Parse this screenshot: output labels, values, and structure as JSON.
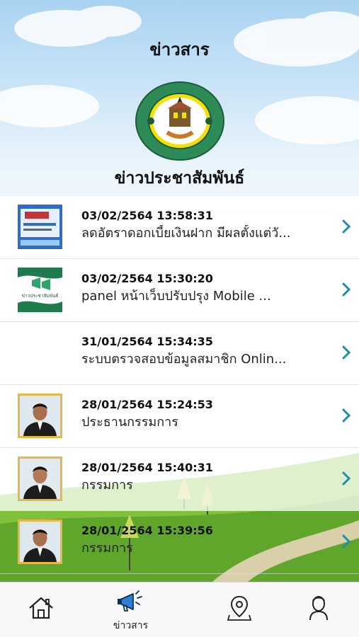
{
  "header": {
    "title": "ข่าวสาร",
    "section_title": "ข่าวประชาสัมพันธ์",
    "logo": {
      "icon": "cooperative-seal-logo",
      "top_text": "สหกรณ์ออมทรัพย์ครู",
      "bottom_text": "นครสวรรค์ จำกัด"
    }
  },
  "news": [
    {
      "date": "03/02/2564 13:58:31",
      "title": "ลดอัตราดอกเบี้ยเงินฝาก มีผลตั้งแต่วั...",
      "thumb": "deposit-rate-thumb"
    },
    {
      "date": "03/02/2564 15:30:20",
      "title": "panel หน้าเว็บปรับปรุง Mobile ...",
      "thumb": "pr-news-thumb",
      "thumb_text": "ข่าวประชาสัมพันธ์"
    },
    {
      "date": "31/01/2564 15:34:35",
      "title": "ระบบตรวจสอบข้อมูลสมาชิก  Onlin...",
      "thumb": "none"
    },
    {
      "date": "28/01/2564 15:24:53",
      "title": "ประธานกรรมการ",
      "thumb": "person-photo"
    },
    {
      "date": "28/01/2564 15:40:31",
      "title": "กรรมการ",
      "thumb": "person-photo"
    },
    {
      "date": "28/01/2564 15:39:56",
      "title": "กรรมการ",
      "thumb": "person-photo"
    }
  ],
  "tabbar": {
    "items": [
      {
        "icon": "home-icon",
        "label": ""
      },
      {
        "icon": "megaphone-icon",
        "label": "ข่าวสาร",
        "active": true
      },
      {
        "icon": "map-pin-icon",
        "label": ""
      },
      {
        "icon": "user-icon",
        "label": ""
      }
    ]
  },
  "colors": {
    "accent": "#1f8ea8",
    "chevron": "#1f8ea8",
    "sky": "#a9d3f2",
    "grass": "#6cae2f"
  }
}
